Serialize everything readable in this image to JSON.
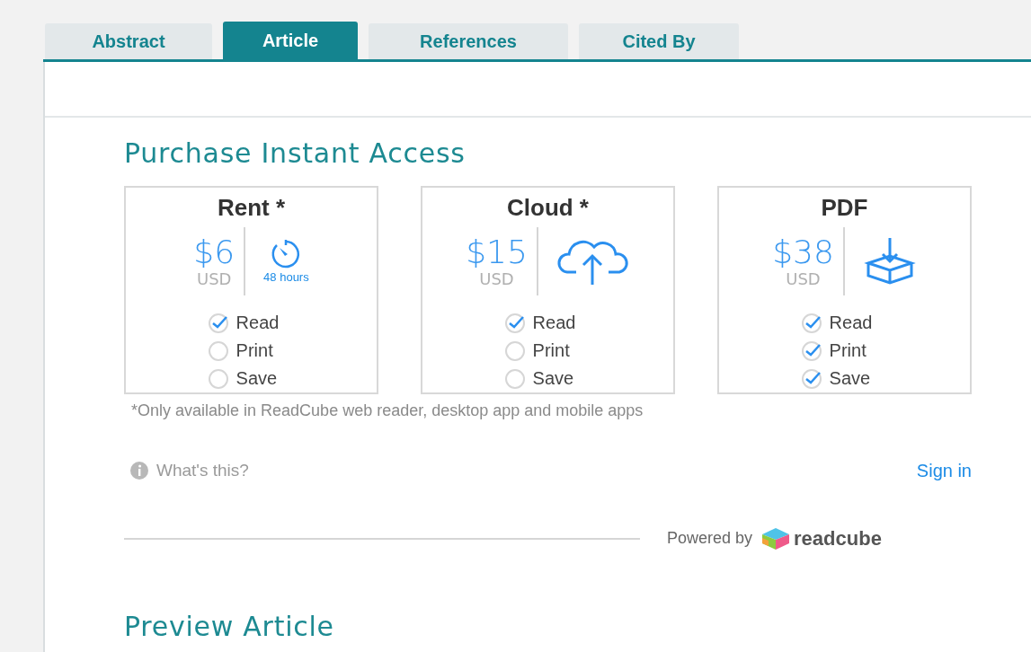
{
  "tabs": [
    {
      "label": "Abstract",
      "selected": false
    },
    {
      "label": "Article",
      "selected": true
    },
    {
      "label": "References",
      "selected": false
    },
    {
      "label": "Cited By",
      "selected": false
    }
  ],
  "purchase": {
    "heading": "Purchase Instant Access",
    "options": [
      {
        "title": "Rent *",
        "price": "$6",
        "currency": "USD",
        "kind": "timer",
        "icon_label": "48 hours",
        "features": [
          {
            "label": "Read",
            "checked": true
          },
          {
            "label": "Print",
            "checked": false
          },
          {
            "label": "Save",
            "checked": false
          }
        ]
      },
      {
        "title": "Cloud *",
        "price": "$15",
        "currency": "USD",
        "kind": "cloud",
        "features": [
          {
            "label": "Read",
            "checked": true
          },
          {
            "label": "Print",
            "checked": false
          },
          {
            "label": "Save",
            "checked": false
          }
        ]
      },
      {
        "title": "PDF",
        "price": "$38",
        "currency": "USD",
        "kind": "download",
        "features": [
          {
            "label": "Read",
            "checked": true
          },
          {
            "label": "Print",
            "checked": true
          },
          {
            "label": "Save",
            "checked": true
          }
        ]
      }
    ],
    "footnote": "*Only available in ReadCube web reader, desktop app and mobile apps",
    "help_link": "What's this?",
    "sign_in": "Sign in",
    "powered_by": "Powered by",
    "brand": "readcube"
  },
  "preview_heading": "Preview Article"
}
